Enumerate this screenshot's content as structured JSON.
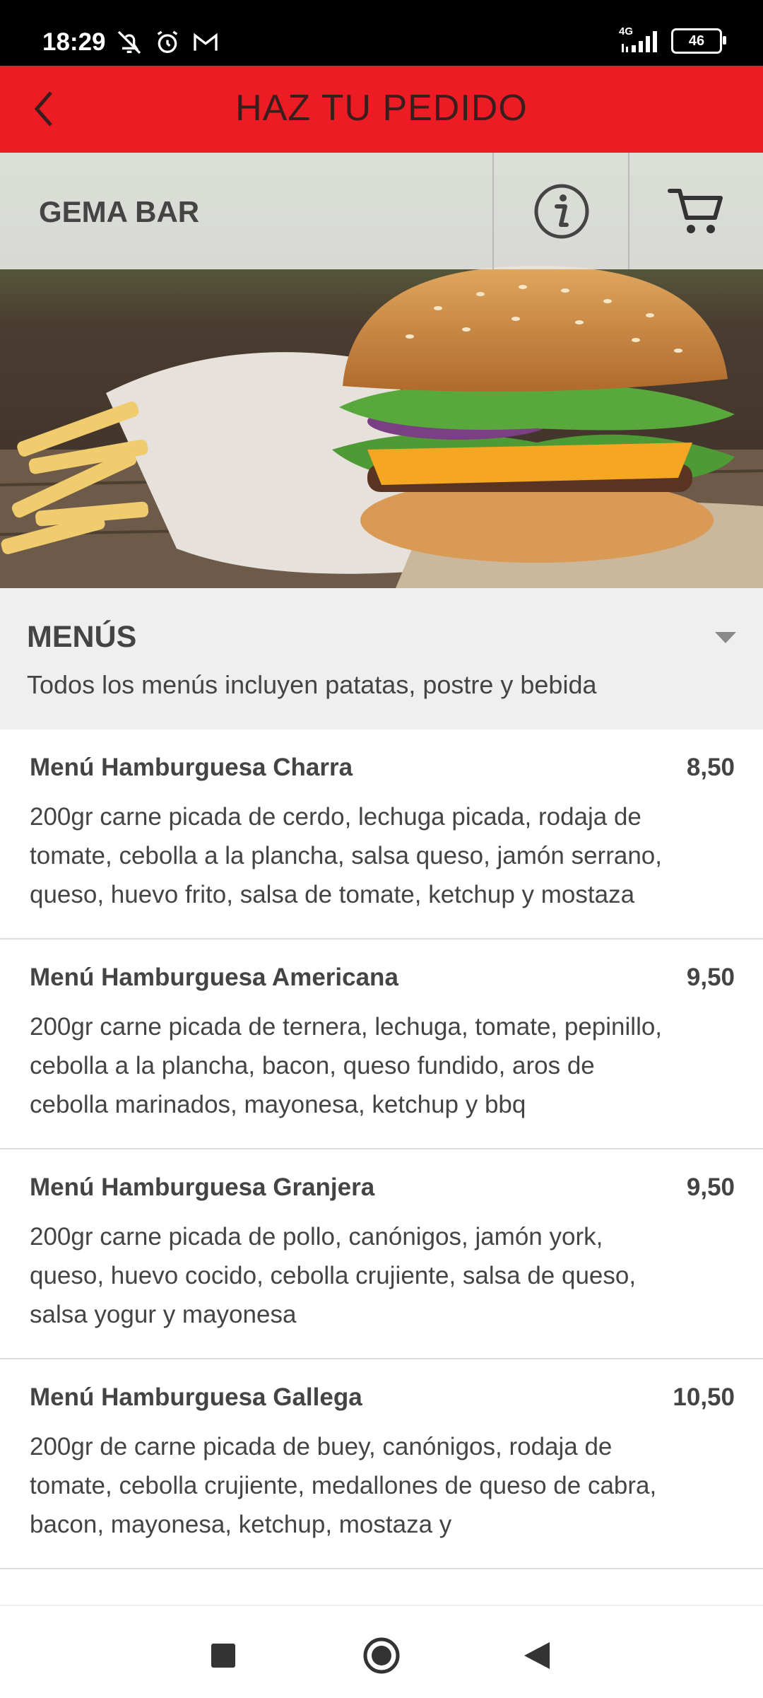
{
  "status_bar": {
    "time": "18:29",
    "network": "4G",
    "battery": "46"
  },
  "header": {
    "title": "HAZ TU PEDIDO",
    "accent_color": "#ed1b24"
  },
  "restaurant": {
    "name": "GEMA BAR"
  },
  "category": {
    "title": "MENÚS",
    "description": "Todos los menús incluyen patatas, postre y bebida"
  },
  "items": [
    {
      "name": "Menú Hamburguesa Charra",
      "price": "8,50",
      "description": "200gr carne picada de cerdo, lechuga picada, rodaja de tomate, cebolla a la plancha, salsa queso, jamón serrano, queso, huevo frito, salsa de tomate, ketchup y mostaza"
    },
    {
      "name": "Menú Hamburguesa Americana",
      "price": "9,50",
      "description": "200gr carne picada de ternera, lechuga, tomate, pepinillo, cebolla a la plancha, bacon, queso fundido, aros de cebolla marinados, mayonesa, ketchup y bbq"
    },
    {
      "name": "Menú Hamburguesa Granjera",
      "price": "9,50",
      "description": "200gr carne picada de pollo, canónigos, jamón york, queso, huevo cocido, cebolla crujiente, salsa de queso, salsa yogur y mayonesa"
    },
    {
      "name": "Menú Hamburguesa Gallega",
      "price": "10,50",
      "description": "200gr de carne picada de buey, canónigos, rodaja de tomate, cebolla crujiente, medallones de queso de cabra, bacon, mayonesa, ketchup, mostaza y"
    }
  ]
}
